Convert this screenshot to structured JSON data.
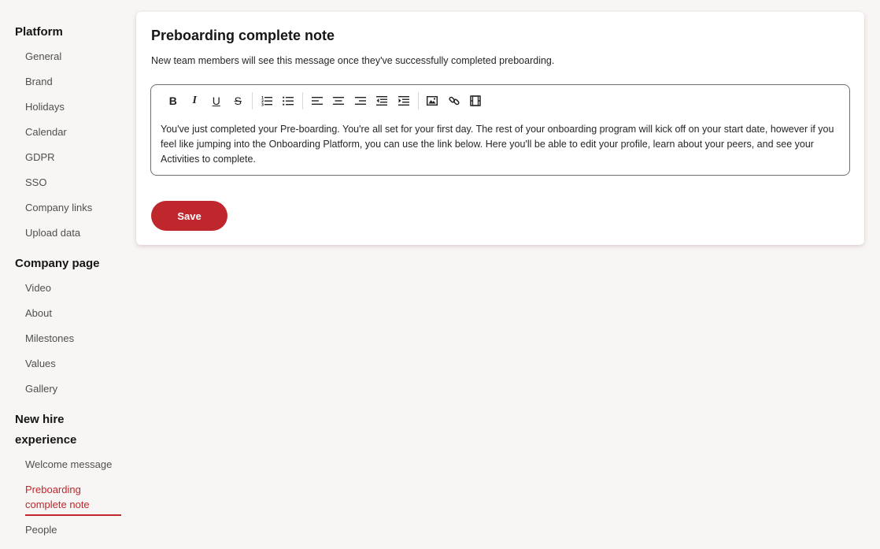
{
  "sidebar": {
    "platform": {
      "title": "Platform",
      "items": [
        "General",
        "Brand",
        "Holidays",
        "Calendar",
        "GDPR",
        "SSO",
        "Company links",
        "Upload data"
      ]
    },
    "company_page": {
      "title": "Company page",
      "items": [
        "Video",
        "About",
        "Milestones",
        "Values",
        "Gallery"
      ]
    },
    "new_hire": {
      "title_line1": "New hire",
      "title_line2": "experience",
      "items": [
        "Welcome message",
        "Preboarding",
        "complete note",
        "People"
      ]
    }
  },
  "card": {
    "title": "Preboarding complete note",
    "description": "New team members will see this message once they've successfully completed preboarding.",
    "editor_text": "You've just completed your Pre-boarding. You're all set for your first day. The rest of your onboarding program will kick off on your start date, however if you feel like jumping into the Onboarding Platform, you can use the link below. Here you'll be able to edit your profile, learn about your peers, and see your Activities to complete.",
    "toolbar": {
      "bold": "B",
      "italic": "I",
      "underline": "U",
      "strike": "S"
    },
    "save_label": "Save"
  },
  "colors": {
    "accent": "#c0272d",
    "background": "#f7f6f4"
  },
  "icons": [
    "bold-icon",
    "italic-icon",
    "underline-icon",
    "strikethrough-icon",
    "ordered-list-icon",
    "bullet-list-icon",
    "align-left-icon",
    "align-center-icon",
    "align-right-icon",
    "outdent-icon",
    "indent-icon",
    "image-icon",
    "link-icon",
    "video-icon"
  ]
}
